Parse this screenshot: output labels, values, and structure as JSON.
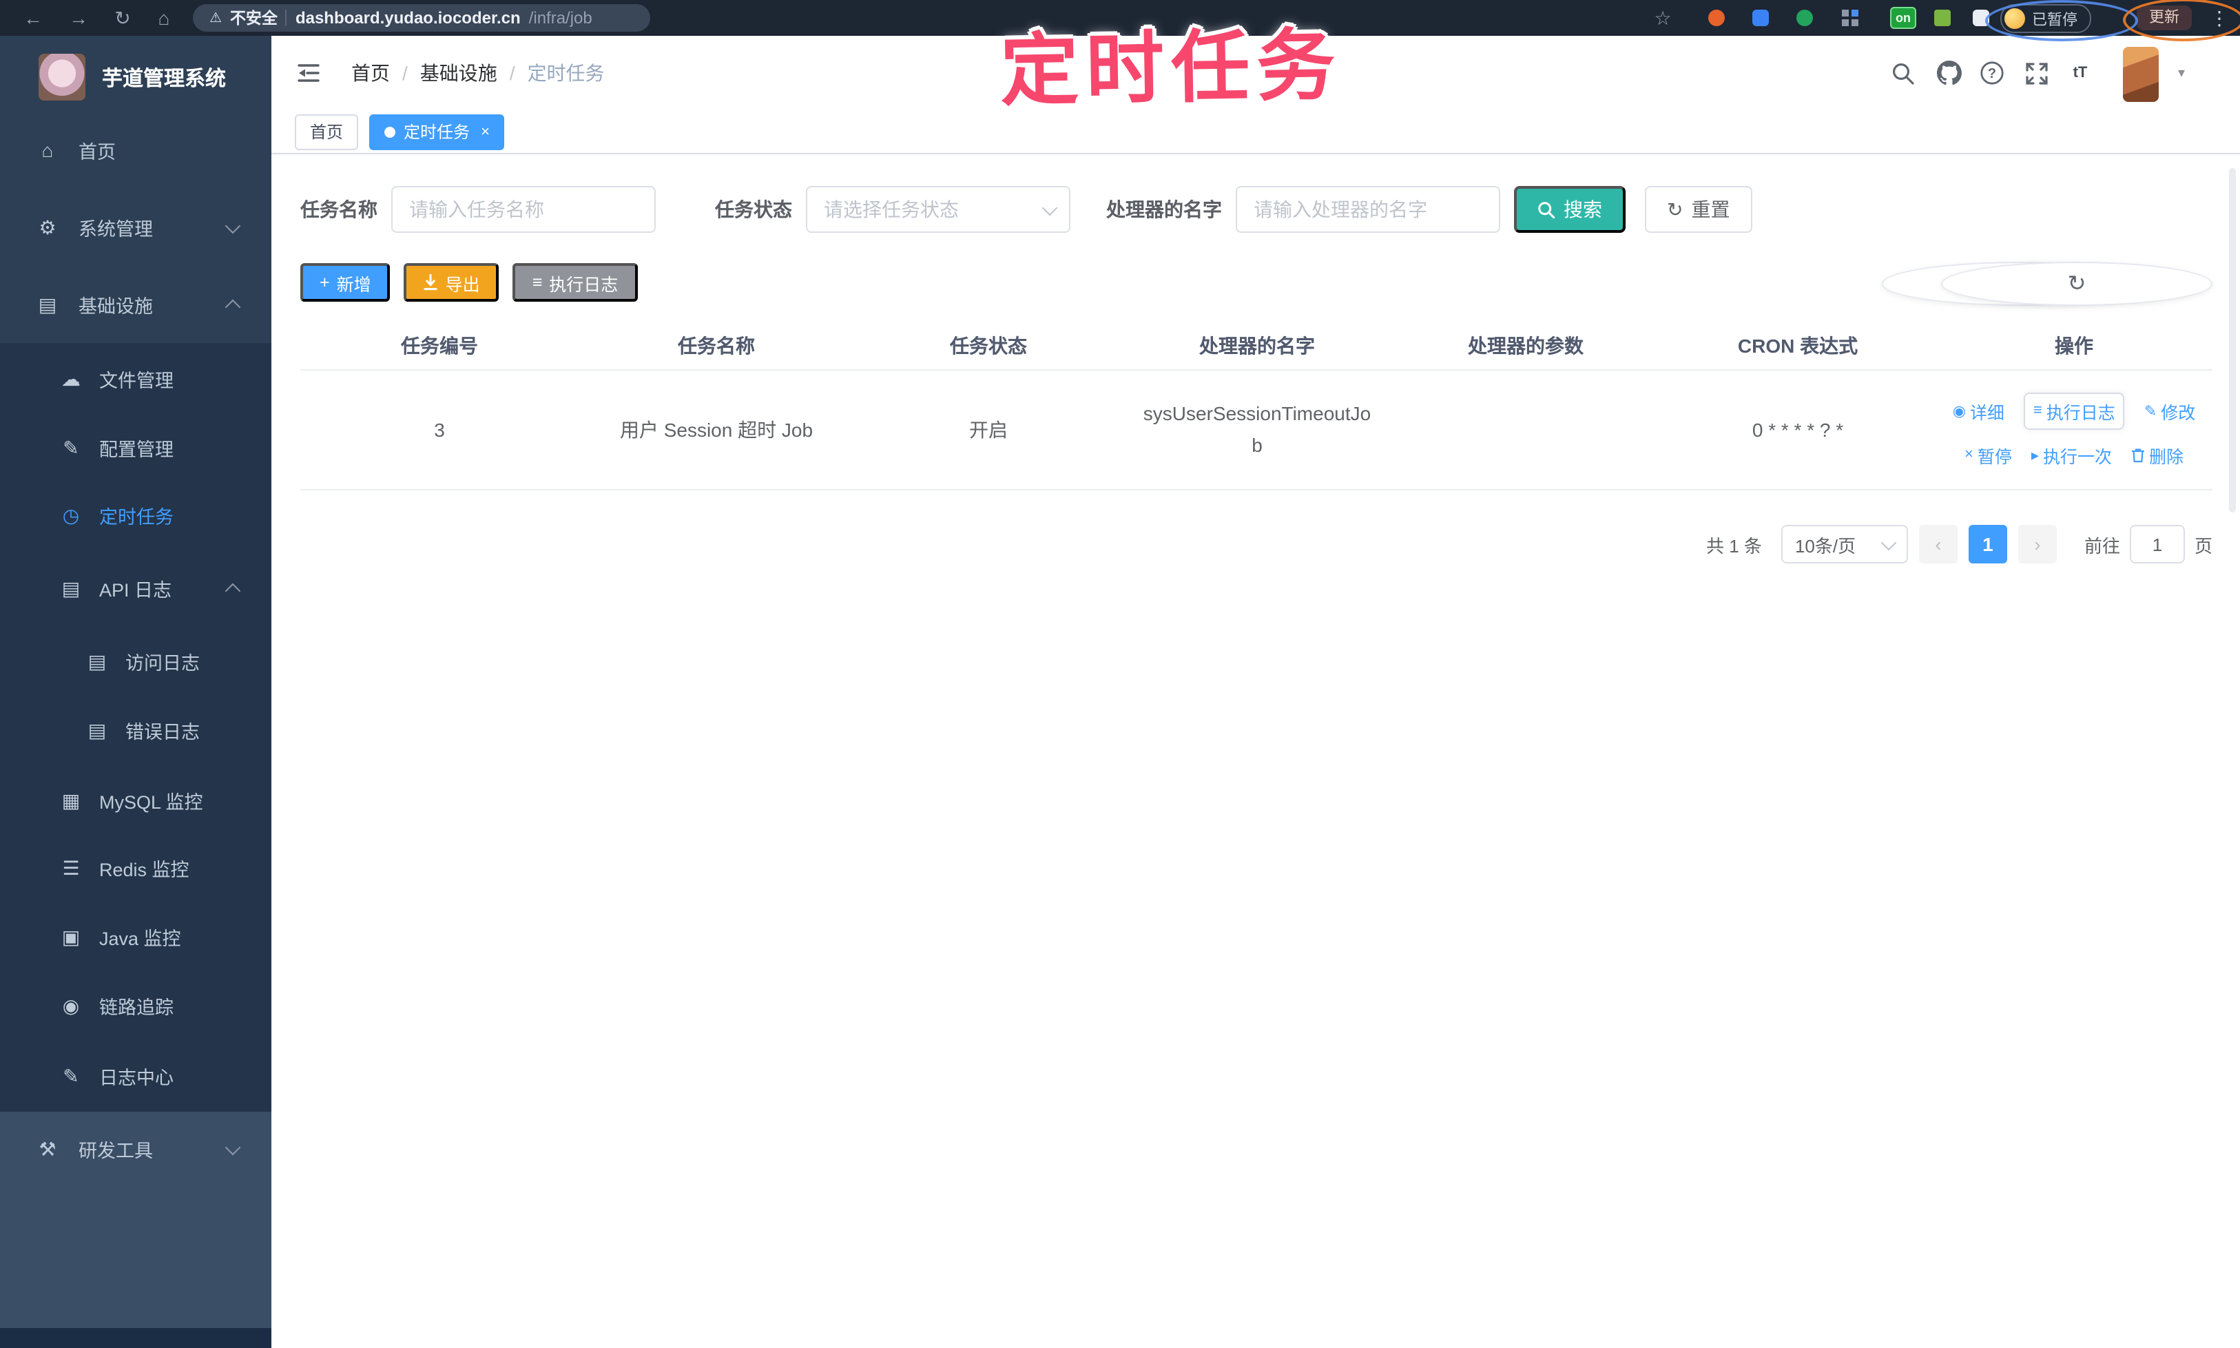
{
  "annotation": {
    "text": "定时任务"
  },
  "browser": {
    "icons": {
      "back": "←",
      "forward": "→",
      "reload": "↻",
      "home": "⌂",
      "warning": "⚠",
      "star": "☆",
      "menu": "⋮"
    },
    "security_text": "不安全",
    "url_domain": "dashboard.yudao.iocoder.cn",
    "url_path": "/infra/job",
    "on_badge": "on",
    "paused_badge": "已暂停",
    "update_button": "更新"
  },
  "sidebar": {
    "title": "芋道管理系统",
    "items": [
      {
        "label": "首页",
        "glyph": "⌂"
      },
      {
        "label": "系统管理",
        "glyph": "⚙"
      },
      {
        "label": "基础设施",
        "glyph": "▤"
      },
      {
        "label": "文件管理",
        "glyph": "☁"
      },
      {
        "label": "配置管理",
        "glyph": "✎"
      },
      {
        "label": "定时任务",
        "glyph": "◷"
      },
      {
        "label": "API 日志",
        "glyph": "▤"
      },
      {
        "label": "访问日志",
        "glyph": "▤"
      },
      {
        "label": "错误日志",
        "glyph": "▤"
      },
      {
        "label": "MySQL 监控",
        "glyph": "▦"
      },
      {
        "label": "Redis 监控",
        "glyph": "☰"
      },
      {
        "label": "Java 监控",
        "glyph": "▣"
      },
      {
        "label": "链路追踪",
        "glyph": "◉"
      },
      {
        "label": "日志中心",
        "glyph": "✎"
      },
      {
        "label": "研发工具",
        "glyph": "⚒"
      }
    ]
  },
  "header": {
    "breadcrumb": [
      "首页",
      "基础设施",
      "定时任务"
    ],
    "separator": "/",
    "help_glyph": "?",
    "font_size_icon": "tT",
    "caret": "▾"
  },
  "tabs": [
    {
      "label": "首页"
    },
    {
      "label": "定时任务",
      "close": "×"
    }
  ],
  "filters": {
    "fields": [
      {
        "label": "任务名称",
        "placeholder": "请输入任务名称"
      },
      {
        "label": "任务状态",
        "placeholder": "请选择任务状态"
      },
      {
        "label": "处理器的名字",
        "placeholder": "请输入处理器的名字"
      }
    ],
    "search_label": "搜索",
    "reset_label": "重置",
    "reset_glyph": "↻"
  },
  "toolbar": {
    "add_glyph": "+",
    "add_label": "新增",
    "export_label": "导出",
    "exec_log_glyph": "≡",
    "exec_log_label": "执行日志",
    "refresh_glyph": "↻"
  },
  "table": {
    "headers": [
      "任务编号",
      "任务名称",
      "任务状态",
      "处理器的名字",
      "处理器的参数",
      "CRON 表达式",
      "操作"
    ],
    "row": {
      "id": "3",
      "name": "用户 Session 超时 Job",
      "status": "开启",
      "handler": "sysUserSessionTimeoutJob",
      "param": "",
      "cron": "0 * * * * ? *"
    },
    "actions_row1": [
      {
        "label": "详细",
        "glyph": "◉"
      },
      {
        "label": "执行日志",
        "glyph": "≡"
      },
      {
        "label": "修改",
        "glyph": "✎"
      }
    ],
    "actions_row2": [
      {
        "label": "暂停",
        "glyph": "×"
      },
      {
        "label": "执行一次",
        "glyph": "▸"
      },
      {
        "label": "删除"
      }
    ]
  },
  "pagination": {
    "total": "共 1 条",
    "page_size": "10条/页",
    "prev": "‹",
    "page": "1",
    "next": "›",
    "goto_label": "前往",
    "goto_value": "1",
    "page_suffix": "页"
  },
  "colors": {
    "accent_blue": "#409eff",
    "search_teal": "#2eb7a7",
    "export_orange": "#f3a41f",
    "info_gray": "#909399",
    "annotation_pink": "#f7476d",
    "sidebar_bg": "#2d3f54",
    "submenu_bg": "#24344a",
    "chrome_bg": "#1d2633",
    "link_blue": "#409eff"
  }
}
